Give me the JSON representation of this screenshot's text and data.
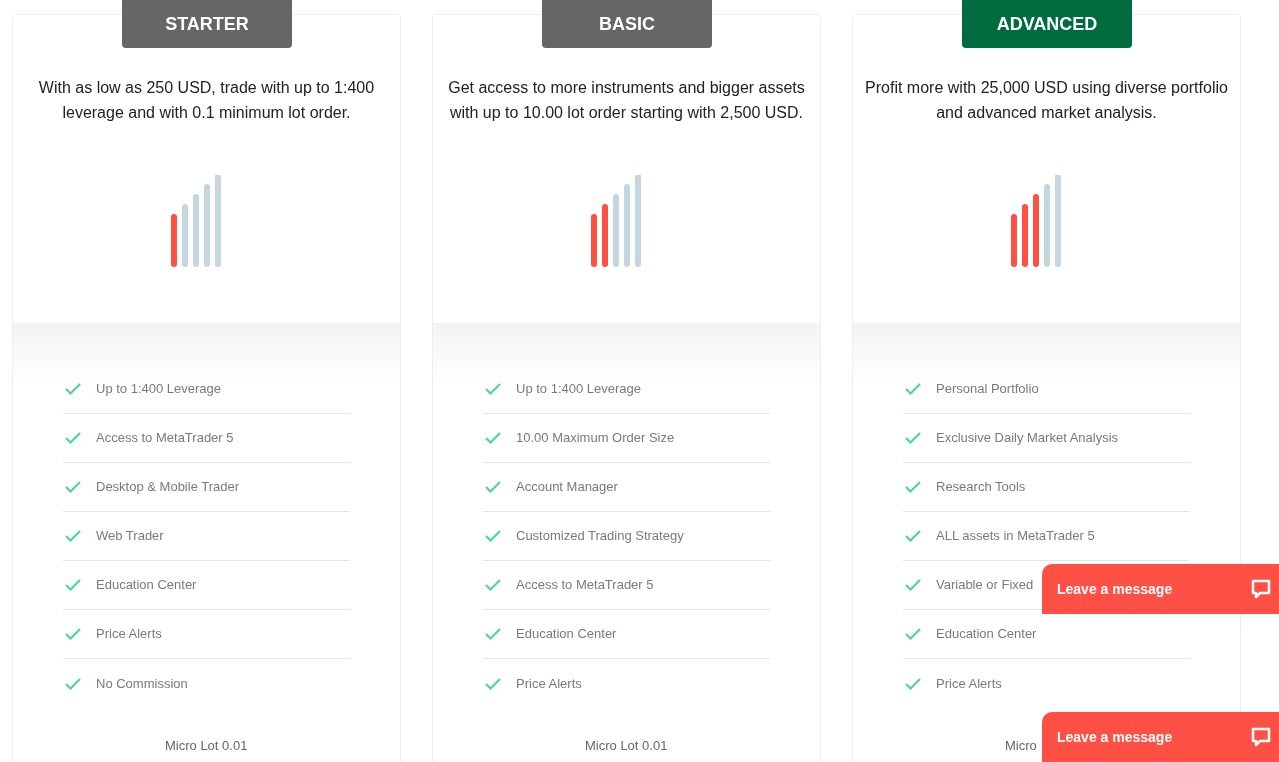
{
  "plans": [
    {
      "name": "STARTER",
      "color": "#666666",
      "description": "With as low as 250 USD, trade with up to 1:400 leverage and with 0.1 minimum lot order.",
      "level": 0.2,
      "features": [
        "Up to 1:400 Leverage",
        "Access to MetaTrader 5",
        "Desktop & Mobile Trader",
        "Web Trader",
        "Education Center",
        "Price Alerts",
        "No Commission"
      ],
      "footer": "Micro Lot 0.01"
    },
    {
      "name": "BASIC",
      "color": "#666666",
      "description": "Get access to more instruments and bigger assets with up to 10.00 lot order starting with 2,500 USD.",
      "level": 0.4,
      "features": [
        "Up to 1:400 Leverage",
        "10.00 Maximum Order Size",
        "Account Manager",
        "Customized Trading Strategy",
        "Access to MetaTrader 5",
        "Education Center",
        "Price Alerts"
      ],
      "footer": "Micro Lot 0.01"
    },
    {
      "name": "ADVANCED",
      "color": "#006b3f",
      "description": "Profit more with 25,000 USD using diverse portfolio and advanced market analysis.",
      "level": 0.6,
      "features": [
        "Personal Portfolio",
        "Exclusive Daily Market Analysis",
        "Research Tools",
        "ALL assets in MetaTrader 5",
        "Variable or Fixed",
        "Education Center",
        "Price Alerts"
      ],
      "footer": "Micro"
    }
  ],
  "chat_widgets": [
    {
      "label": "Leave a message"
    },
    {
      "label": "Leave a message"
    }
  ]
}
